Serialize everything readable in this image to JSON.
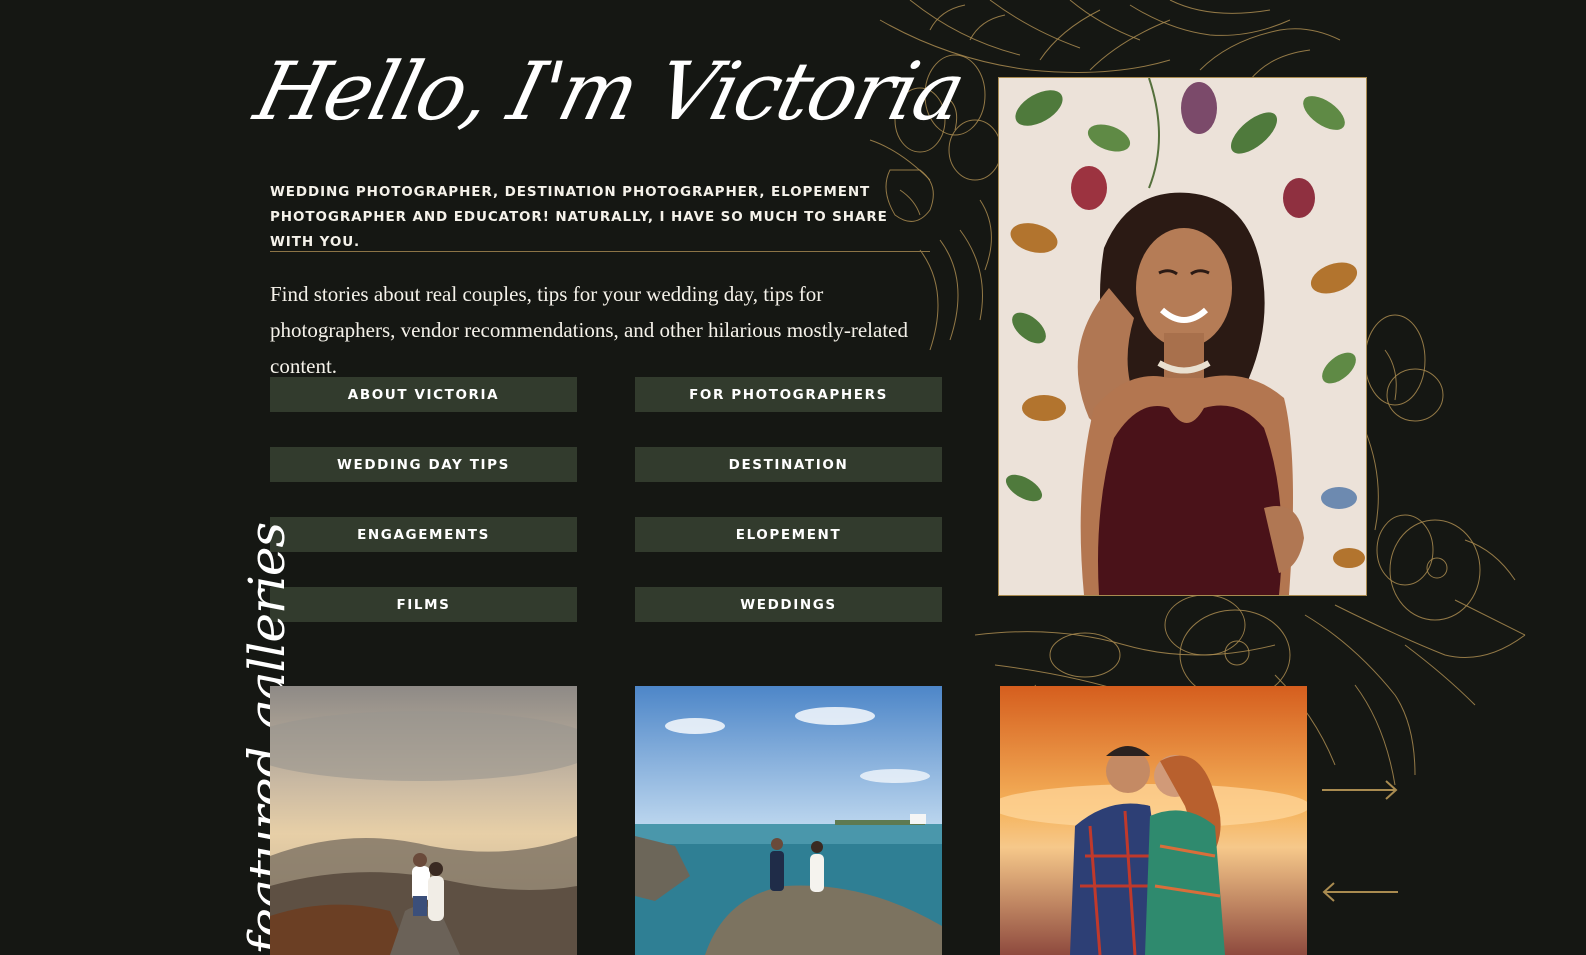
{
  "hero": {
    "headline": "Hello, I'm Victoria",
    "intro": "Wedding photographer, destination photographer, elopement photographer and educator! Naturally, I have so much to share with you.",
    "lede": "Find stories about real couples, tips for your wedding day, tips for photographers, vendor recommendations, and other hilarious mostly-related content."
  },
  "categories": [
    {
      "label": "About Victoria"
    },
    {
      "label": "For Photographers"
    },
    {
      "label": "Wedding Day Tips"
    },
    {
      "label": "Destination"
    },
    {
      "label": "Engagements"
    },
    {
      "label": "Elopement"
    },
    {
      "label": "Films"
    },
    {
      "label": "Weddings"
    }
  ],
  "featured": {
    "label": "featured galleries",
    "tiles": [
      {
        "scene": "mountain-overlook-couple"
      },
      {
        "scene": "seaside-rocks-couple"
      },
      {
        "scene": "sunset-embrace-couple"
      }
    ],
    "next_icon": "arrow-right-icon",
    "prev_icon": "arrow-left-icon"
  },
  "colors": {
    "background": "#151713",
    "button": "#323b2d",
    "accent_gold": "#a98b50",
    "text": "#f5f2ea"
  }
}
